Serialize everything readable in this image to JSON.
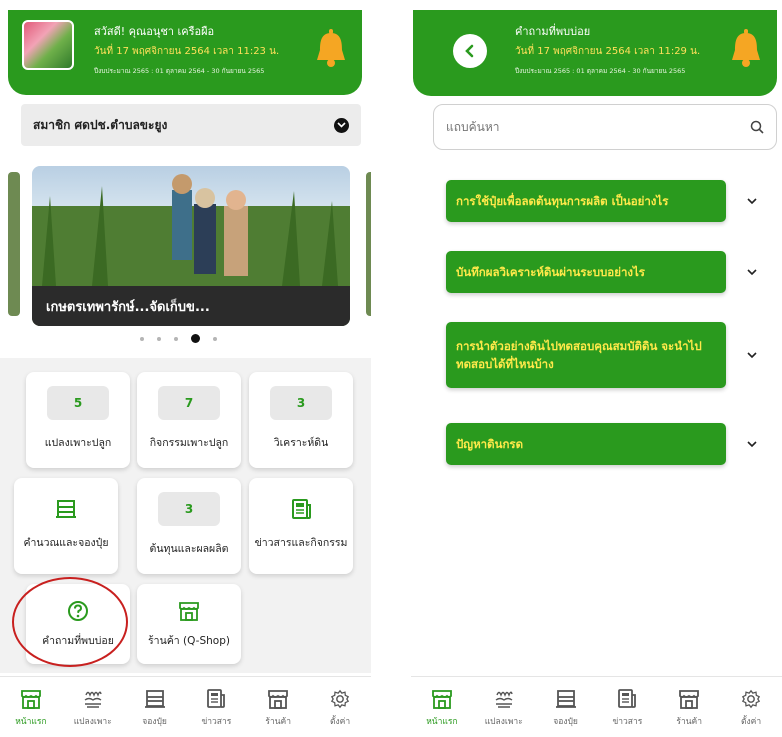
{
  "colors": {
    "brand_green": "#2a9a1e",
    "accent_yellow": "#ffe94a",
    "bell_orange": "#f5a623",
    "highlight_red": "#c8201f"
  },
  "home": {
    "header": {
      "greeting": "สวัสดี! คุณอนุชา เครือผือ",
      "date": "วันที่ 17 พฤศจิกายน 2564 เวลา 11:23 น.",
      "budget": "ปีงบประมาณ 2565 : 01 ตุลาคม 2564 - 30 กันยายน 2565"
    },
    "member_select": "สมาชิก ศดปช.ตำบลขะยูง",
    "carousel": {
      "caption": "เกษตรเทพารักษ์...จัดเก็บข...",
      "dot_count": 5,
      "active_dot": 4
    },
    "cards": [
      {
        "value": "5",
        "label": "แปลงเพาะปลูก",
        "icon": ""
      },
      {
        "value": "7",
        "label": "กิจกรรมเพาะปลูก",
        "icon": ""
      },
      {
        "value": "3",
        "label": "วิเคราะห์ดิน",
        "icon": ""
      },
      {
        "value": "",
        "label": "คำนวณและจองปุ๋ย",
        "icon": "fertilizer-icon"
      },
      {
        "value": "3",
        "label": "ต้นทุนและผลผลิต",
        "icon": ""
      },
      {
        "value": "",
        "label": "ข่าวสารและกิจกรรม",
        "icon": "news-icon"
      },
      {
        "value": "",
        "label": "คำถามที่พบบ่อย",
        "icon": "question-icon"
      },
      {
        "value": "",
        "label": "ร้านค้า (Q-Shop)",
        "icon": "shop-icon"
      }
    ]
  },
  "faq": {
    "header": {
      "title": "คำถามที่พบบ่อย",
      "date": "วันที่ 17 พฤศจิกายน 2564 เวลา 11:29 น.",
      "budget": "ปีงบประมาณ 2565 : 01 ตุลาคม 2564 - 30 กันยายน 2565"
    },
    "search_placeholder": "แถบค้นหา",
    "questions": [
      "การใช้ปุ๋ยเพื่อลดต้นทุนการผลิต เป็นอย่างไร",
      "บันทึกผลวิเคราะห์ดินผ่านระบบอย่างไร",
      "การนำตัวอย่างดินไปทดสอบคุณสมบัติดิน จะนำไปทดสอบได้ที่ไหนบ้าง",
      "ปัญหาดินกรด"
    ]
  },
  "nav": [
    {
      "label": "หน้าแรก",
      "icon": "home-shop-icon"
    },
    {
      "label": "แปลงเพาะ",
      "icon": "plant-icon"
    },
    {
      "label": "จองปุ๋ย",
      "icon": "fertilizer-icon"
    },
    {
      "label": "ข่าวสาร",
      "icon": "news-icon"
    },
    {
      "label": "ร้านค้า",
      "icon": "shop-icon"
    },
    {
      "label": "ตั้งค่า",
      "icon": "gear-icon"
    }
  ]
}
